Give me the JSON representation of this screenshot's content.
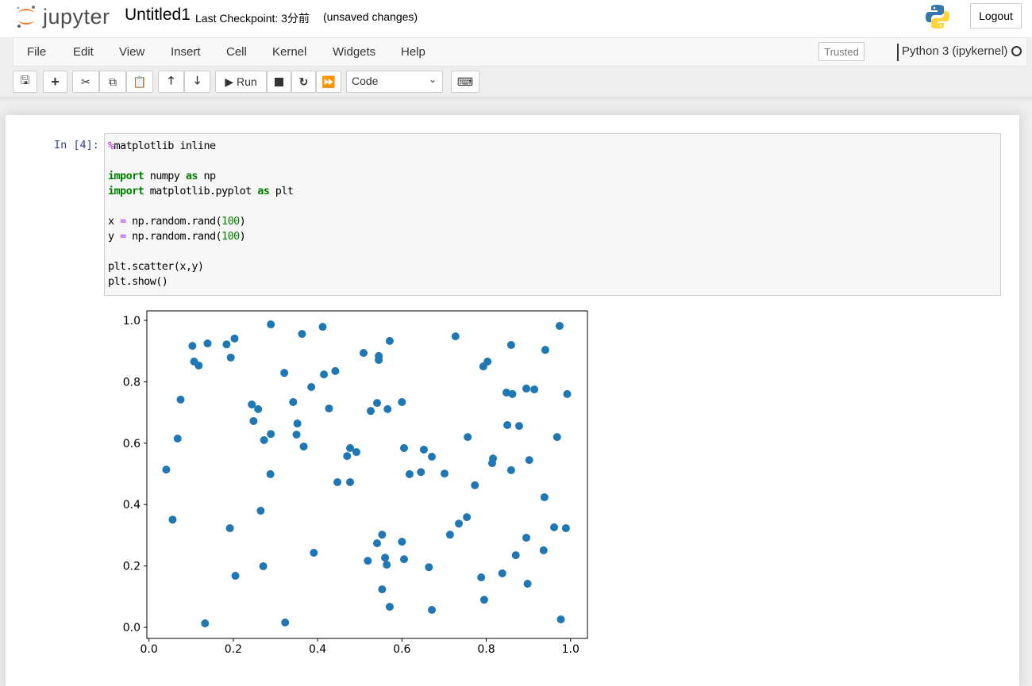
{
  "header": {
    "logo_text": "jupyter",
    "notebook_name": "Untitled1",
    "checkpoint": "Last Checkpoint: 3分前",
    "unsaved": "(unsaved changes)",
    "logout_label": "Logout"
  },
  "menubar": {
    "items": [
      "File",
      "Edit",
      "View",
      "Insert",
      "Cell",
      "Kernel",
      "Widgets",
      "Help"
    ],
    "trusted_label": "Trusted",
    "kernel_name": "Python 3 (ipykernel)"
  },
  "toolbar": {
    "buttons": [
      "save-icon",
      "plus-icon",
      "cut-icon",
      "copy-icon",
      "paste-icon",
      "arrow-up-icon",
      "arrow-down-icon",
      "run-icon",
      "stop-icon",
      "restart-icon",
      "fast-forward-icon",
      "keyboard-icon"
    ],
    "run_label": "Run",
    "cell_type": "Code"
  },
  "cell": {
    "prompt": "In [4]:",
    "code_lines": [
      [
        [
          "%",
          "magic"
        ],
        [
          "matplotlib inline",
          "plain"
        ]
      ],
      [],
      [
        [
          "import",
          "kw"
        ],
        [
          " numpy ",
          "plain"
        ],
        [
          "as",
          "kw"
        ],
        [
          " np",
          "plain"
        ]
      ],
      [
        [
          "import",
          "kw"
        ],
        [
          " matplotlib.pyplot ",
          "plain"
        ],
        [
          "as",
          "kw"
        ],
        [
          " plt",
          "plain"
        ]
      ],
      [],
      [
        [
          "x ",
          "plain"
        ],
        [
          "=",
          "op"
        ],
        [
          " np.random.rand(",
          "plain"
        ],
        [
          "100",
          "num"
        ],
        [
          ")",
          "plain"
        ]
      ],
      [
        [
          "y ",
          "plain"
        ],
        [
          "=",
          "op"
        ],
        [
          " np.random.rand(",
          "plain"
        ],
        [
          "100",
          "num"
        ],
        [
          ")",
          "plain"
        ]
      ],
      [],
      [
        [
          "plt.scatter(x,y)",
          "plain"
        ]
      ],
      [
        [
          "plt.show()",
          "plain"
        ]
      ]
    ]
  },
  "chart_data": {
    "type": "scatter",
    "title": "",
    "xlabel": "",
    "ylabel": "",
    "xlim": [
      -0.005,
      1.04
    ],
    "ylim": [
      -0.036,
      1.031
    ],
    "xticks": [
      "0.0",
      "0.2",
      "0.4",
      "0.6",
      "0.8",
      "1.0"
    ],
    "yticks": [
      "0.0",
      "0.2",
      "0.4",
      "0.6",
      "0.8",
      "1.0"
    ],
    "grid": false,
    "color": "#1f77b4",
    "x": [
      0.041,
      0.056,
      0.068,
      0.075,
      0.103,
      0.107,
      0.118,
      0.133,
      0.139,
      0.184,
      0.192,
      0.194,
      0.203,
      0.205,
      0.244,
      0.248,
      0.259,
      0.265,
      0.271,
      0.273,
      0.288,
      0.289,
      0.289,
      0.321,
      0.323,
      0.342,
      0.352,
      0.35,
      0.363,
      0.367,
      0.385,
      0.391,
      0.412,
      0.415,
      0.427,
      0.442,
      0.447,
      0.47,
      0.477,
      0.477,
      0.492,
      0.509,
      0.519,
      0.526,
      0.541,
      0.541,
      0.545,
      0.545,
      0.553,
      0.553,
      0.56,
      0.564,
      0.566,
      0.571,
      0.571,
      0.6,
      0.6,
      0.605,
      0.605,
      0.618,
      0.645,
      0.652,
      0.664,
      0.671,
      0.671,
      0.701,
      0.714,
      0.727,
      0.735,
      0.754,
      0.756,
      0.773,
      0.788,
      0.793,
      0.795,
      0.803,
      0.814,
      0.816,
      0.838,
      0.848,
      0.85,
      0.859,
      0.859,
      0.862,
      0.87,
      0.878,
      0.895,
      0.895,
      0.898,
      0.902,
      0.914,
      0.936,
      0.938,
      0.94,
      0.961,
      0.968,
      0.974,
      0.977,
      0.989,
      0.992
    ],
    "y": [
      0.514,
      0.351,
      0.615,
      0.742,
      0.917,
      0.866,
      0.853,
      0.013,
      0.925,
      0.922,
      0.323,
      0.879,
      0.941,
      0.168,
      0.726,
      0.672,
      0.711,
      0.38,
      0.199,
      0.61,
      0.499,
      0.63,
      0.987,
      0.829,
      0.016,
      0.734,
      0.664,
      0.628,
      0.956,
      0.589,
      0.783,
      0.243,
      0.979,
      0.824,
      0.713,
      0.835,
      0.473,
      0.558,
      0.584,
      0.473,
      0.571,
      0.894,
      0.217,
      0.705,
      0.731,
      0.274,
      0.884,
      0.871,
      0.302,
      0.124,
      0.227,
      0.204,
      0.711,
      0.067,
      0.933,
      0.279,
      0.734,
      0.222,
      0.584,
      0.499,
      0.506,
      0.579,
      0.196,
      0.556,
      0.057,
      0.501,
      0.302,
      0.948,
      0.338,
      0.359,
      0.62,
      0.463,
      0.163,
      0.85,
      0.09,
      0.866,
      0.535,
      0.55,
      0.176,
      0.765,
      0.659,
      0.512,
      0.92,
      0.76,
      0.235,
      0.656,
      0.292,
      0.778,
      0.142,
      0.545,
      0.775,
      0.251,
      0.424,
      0.904,
      0.326,
      0.62,
      0.982,
      0.026,
      0.323,
      0.76
    ]
  }
}
